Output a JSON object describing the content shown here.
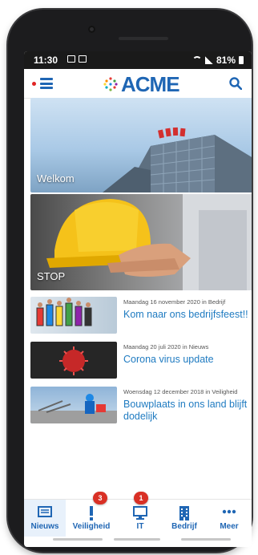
{
  "statusbar": {
    "time": "11:30",
    "battery": "81%"
  },
  "header": {
    "logo_text": "ACME"
  },
  "heroes": [
    {
      "label": "Welkom"
    },
    {
      "label": "STOP"
    }
  ],
  "news": [
    {
      "meta": "Maandag 16 november 2020 in Bedrijf",
      "title": "Kom naar ons bedrijfsfeest!!"
    },
    {
      "meta": "Maandag 20 juli 2020 in Nieuws",
      "title": "Corona virus update"
    },
    {
      "meta": "Woensdag 12 december 2018 in Veiligheid",
      "title": "Bouwplaats in ons land blijft dodelijk"
    }
  ],
  "nav": [
    {
      "label": "Nieuws",
      "icon": "newspaper-icon",
      "badge": ""
    },
    {
      "label": "Veiligheid",
      "icon": "exclamation-icon",
      "badge": "3"
    },
    {
      "label": "IT",
      "icon": "monitor-icon",
      "badge": "1"
    },
    {
      "label": "Bedrijf",
      "icon": "building-icon",
      "badge": ""
    },
    {
      "label": "Meer",
      "icon": "more-icon",
      "badge": ""
    }
  ],
  "colors": {
    "brand": "#1f66b4",
    "link": "#1f7bc1",
    "badge": "#d93025",
    "notification_dot": "#e02424"
  }
}
